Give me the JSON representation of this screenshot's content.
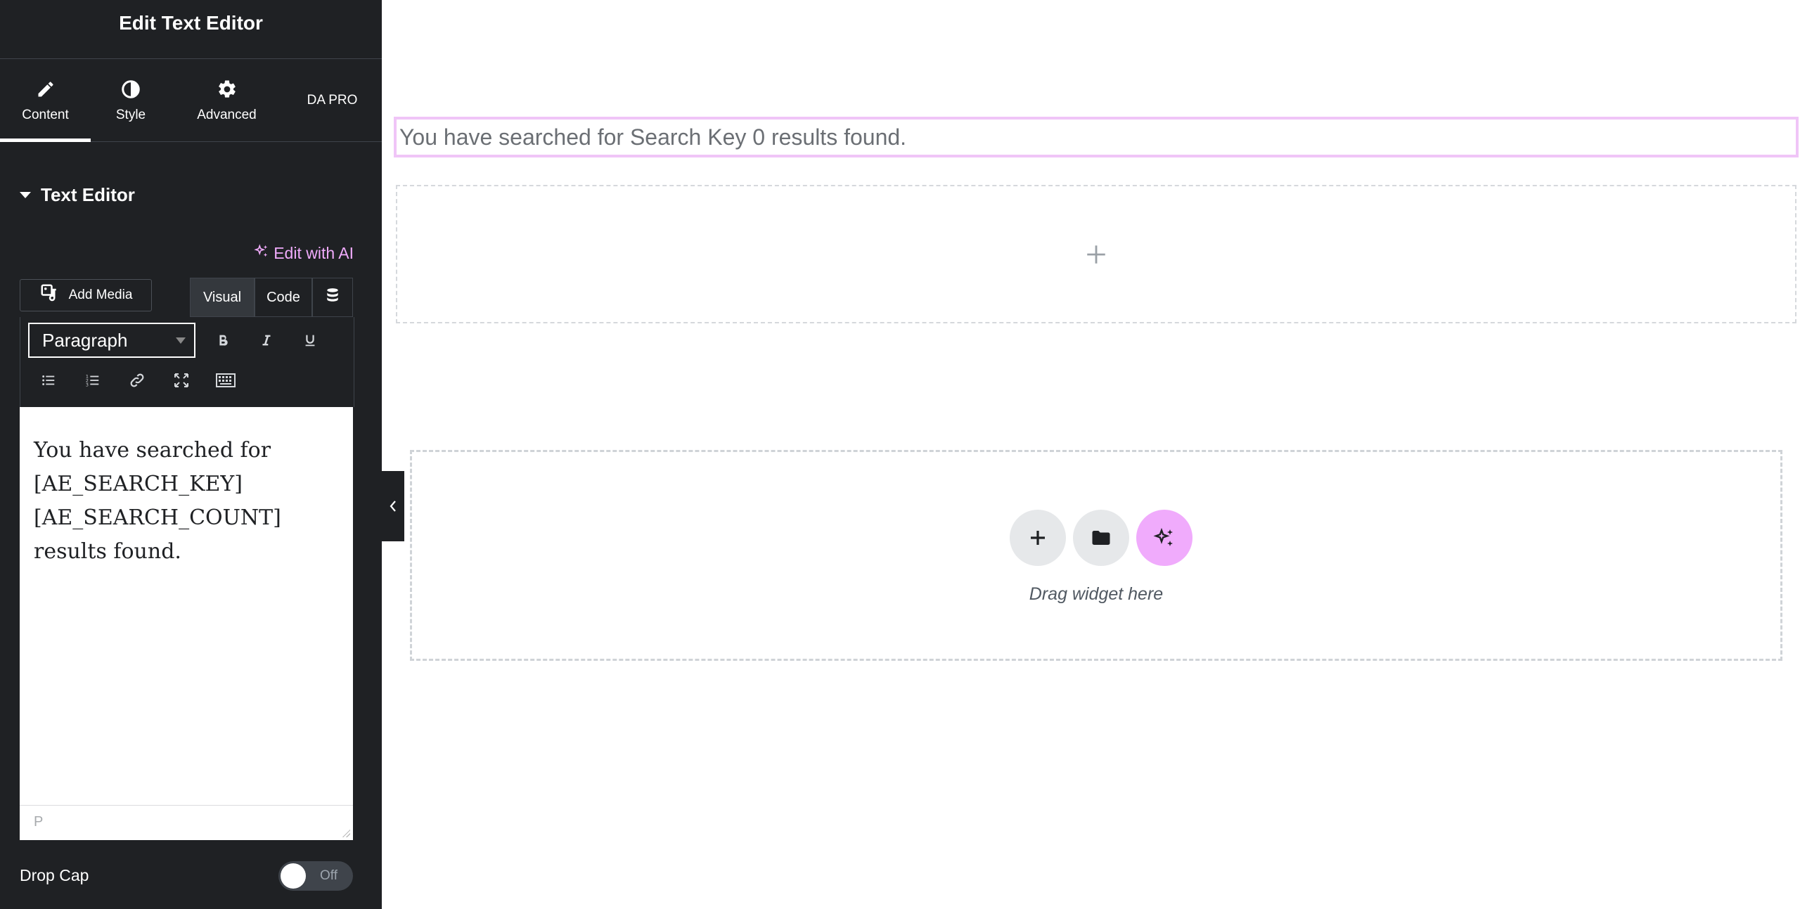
{
  "panel": {
    "title": "Edit Text Editor",
    "tabs": [
      {
        "label": "Content",
        "icon": "pencil-icon",
        "active": true
      },
      {
        "label": "Style",
        "icon": "half-circle-icon",
        "active": false
      },
      {
        "label": "Advanced",
        "icon": "gear-icon",
        "active": false
      },
      {
        "label": "DA PRO",
        "icon": "",
        "active": false
      }
    ],
    "section_title": "Text Editor",
    "ai_link": "Edit with AI",
    "add_media": "Add Media",
    "mode_tabs": {
      "visual": "Visual",
      "code": "Code"
    },
    "format_select": "Paragraph",
    "editor_lines": [
      "You have searched for",
      "[AE_SEARCH_KEY]",
      "[AE_SEARCH_COUNT]",
      "results found."
    ],
    "status_path": "P",
    "drop_cap": {
      "label": "Drop Cap",
      "state": "Off"
    }
  },
  "canvas": {
    "result_text": "You have searched for Search Key 0 results found.",
    "drop_zone_text": "Drag widget here"
  },
  "colors": {
    "panel_bg": "#1f2124",
    "accent_pink": "#f0abfc",
    "selection_border": "#f0c5f7"
  }
}
